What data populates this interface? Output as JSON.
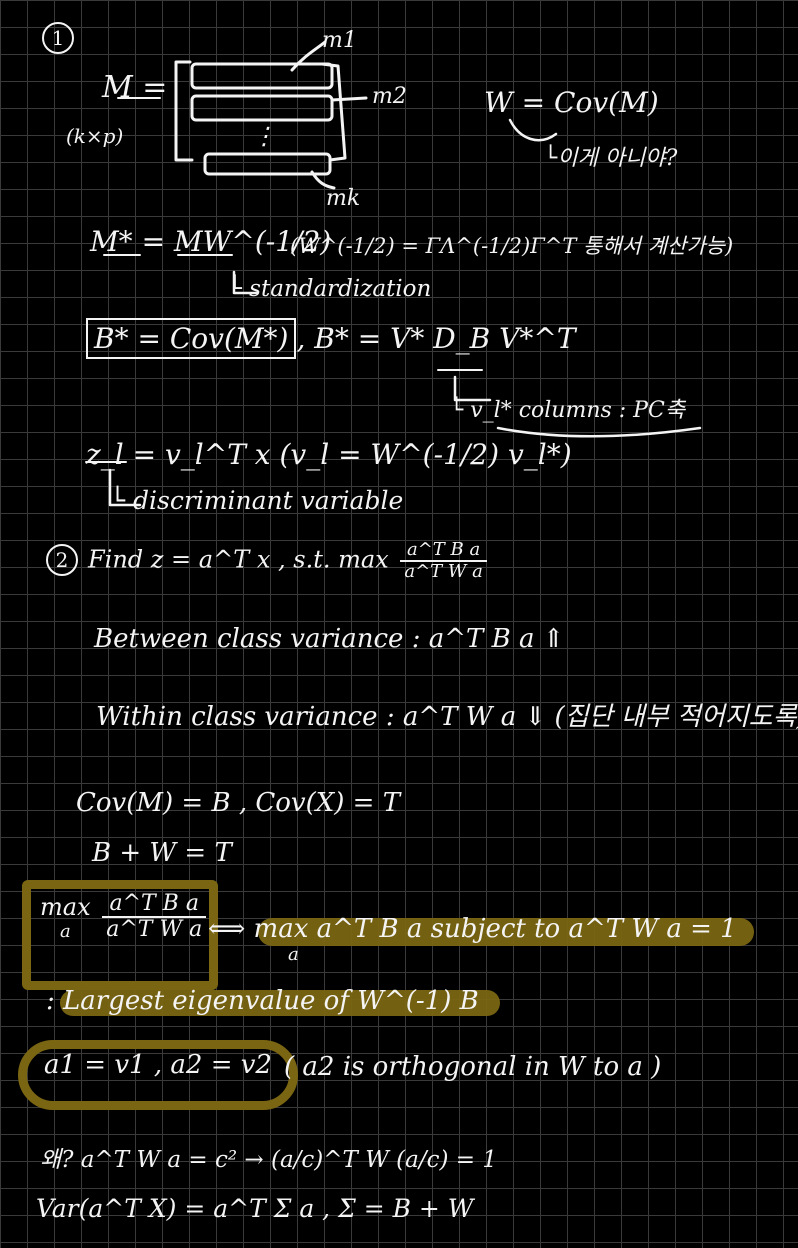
{
  "section1": {
    "marker": "1",
    "m_label": "M",
    "m_dims": "(k×p)",
    "equals": "=",
    "row_labels": [
      "m1",
      "m2",
      "mk"
    ],
    "dots": "⋮",
    "w_def": "W = Cov(M)",
    "w_note": "└이게 아니야?",
    "m_star": "M* = MW^(-1/2)",
    "m_star_note": "(W^(-1/2) = ΓΛ^(-1/2)Γ^T 통해서 계산가능)",
    "standardization": "└ standardization",
    "b_star_boxed": "B* = Cov(M*)",
    "b_star_svd": ", B* = V* D_B V*^T",
    "vl_note": "└ v_l* columns : PC축",
    "z_def": "z_l = v_l^T x (v_l = W^(-1/2) v_l*)",
    "discriminant": "└ discriminant variable"
  },
  "section2": {
    "marker": "2",
    "find": "Find z = a^T x , s.t. max",
    "find_num": "a^T B a",
    "find_den": "a^T W a",
    "between": "Between class variance : a^T B a ⇑",
    "within": "Within class variance : a^T W a ⇓ (집단 내부 적어지도록)",
    "cov_line": "Cov(M) = B , Cov(X) = T",
    "sum_line": "B + W = T",
    "max_label": "max",
    "max_sub": "a",
    "ratio_num": "a^T B a",
    "ratio_den": "a^T W a",
    "equiv": "⟺ max a^T B a subject to a^T W a = 1",
    "equiv_sub": "a",
    "eigen": ": Largest eigenvalue of W^(-1) B",
    "a_vals": "a1 = v1 , a2 = v2",
    "orth": "( a2 is orthogonal in W to a )",
    "why": "왜? a^T W a = c² → (a/c)^T W (a/c) = 1",
    "var_line": "Var(a^T X) = a^T Σ a , Σ = B + W"
  },
  "colors": {
    "highlight": "#7a6512",
    "ink": "#f4f4f4",
    "background": "#000000",
    "grid": "#3a3a3a"
  }
}
